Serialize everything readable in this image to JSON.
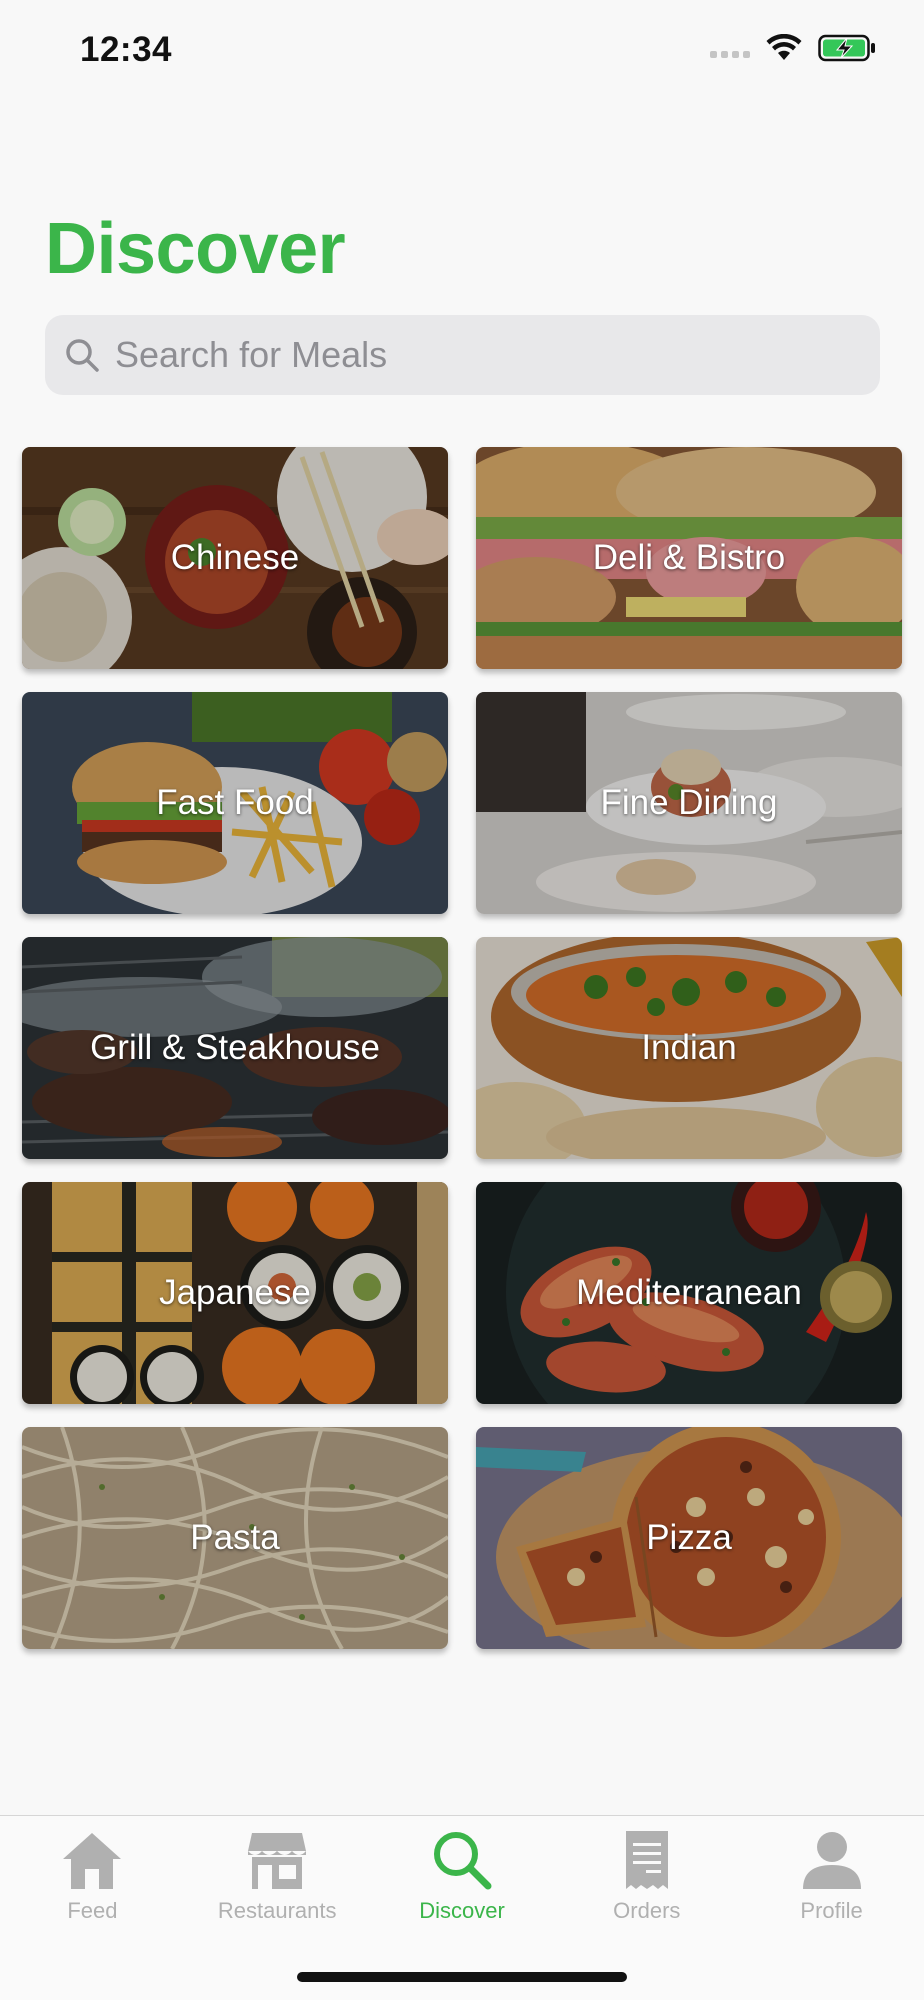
{
  "status_bar": {
    "time": "12:34"
  },
  "page": {
    "title": "Discover"
  },
  "search": {
    "placeholder": "Search for Meals",
    "value": ""
  },
  "categories": [
    {
      "label": "Chinese"
    },
    {
      "label": "Deli & Bistro"
    },
    {
      "label": "Fast Food"
    },
    {
      "label": "Fine Dining"
    },
    {
      "label": "Grill & Steakhouse"
    },
    {
      "label": "Indian"
    },
    {
      "label": "Japanese"
    },
    {
      "label": "Mediterranean"
    },
    {
      "label": "Pasta"
    },
    {
      "label": "Pizza"
    }
  ],
  "tabs": [
    {
      "label": "Feed",
      "icon": "home-icon"
    },
    {
      "label": "Restaurants",
      "icon": "storefront-icon"
    },
    {
      "label": "Discover",
      "icon": "search-icon",
      "active": true
    },
    {
      "label": "Orders",
      "icon": "receipt-icon"
    },
    {
      "label": "Profile",
      "icon": "person-icon"
    }
  ],
  "colors": {
    "accent": "#3bb54a",
    "inactive": "#b0b0b0",
    "background": "#f8f8f8"
  }
}
